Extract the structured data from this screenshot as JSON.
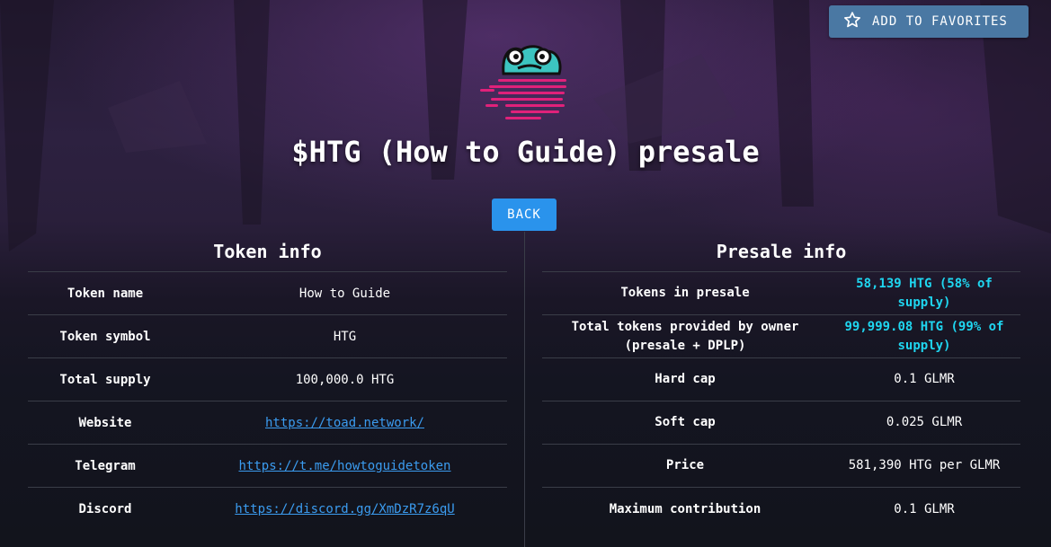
{
  "header": {
    "favorites_label": "ADD TO FAVORITES",
    "title": "$HTG (How to Guide) presale",
    "back_label": "BACK"
  },
  "icons": {
    "favorites": "star-outline-icon",
    "logo": "frog-logo"
  },
  "colors": {
    "favorites_button": "#4a78a3",
    "back_button": "#2a93ec",
    "link": "#3b9cf0",
    "highlight": "#1fd6f0",
    "logo_stripes": "#e0217a",
    "logo_frog": "#3cc4c0"
  },
  "token_info": {
    "heading": "Token info",
    "rows": [
      {
        "label": "Token name",
        "value": "How to Guide"
      },
      {
        "label": "Token symbol",
        "value": "HTG"
      },
      {
        "label": "Total supply",
        "value": "100,000.0 HTG"
      },
      {
        "label": "Website",
        "value": "https://toad.network/"
      },
      {
        "label": "Telegram",
        "value": "https://t.me/howtoguidetoken"
      },
      {
        "label": "Discord",
        "value": "https://discord.gg/XmDzR7z6qU"
      }
    ]
  },
  "presale_info": {
    "heading": "Presale info",
    "rows": [
      {
        "label": "Tokens in presale",
        "value": "58,139 HTG (58% of supply)"
      },
      {
        "label": "Total tokens provided by owner (presale + DPLP)",
        "value": "99,999.08 HTG (99% of supply)"
      },
      {
        "label": "Hard cap",
        "value": "0.1 GLMR"
      },
      {
        "label": "Soft cap",
        "value": "0.025 GLMR"
      },
      {
        "label": "Price",
        "value": "581,390 HTG per GLMR"
      },
      {
        "label": "Maximum contribution",
        "value": "0.1 GLMR"
      }
    ]
  }
}
